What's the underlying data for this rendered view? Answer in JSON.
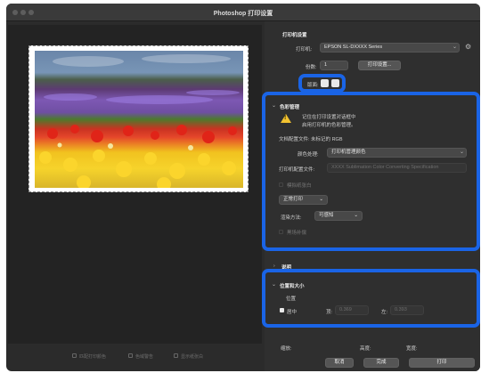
{
  "window": {
    "title": "Photoshop 打印设置"
  },
  "colors": {
    "highlight": "#1a64e6",
    "warning": "#f2c230"
  },
  "printer_setup": {
    "header": "打印机设置",
    "printer_label": "打印机:",
    "printer_value": "EPSON SL-DXXXX Series",
    "copies_label": "份数:",
    "copies_value": "1",
    "print_settings_button": "打印设置...",
    "layout_label": "版面:",
    "layout_icons": [
      "portrait-icon",
      "landscape-icon"
    ]
  },
  "color_management": {
    "header": "色彩管理",
    "warning_line1": "记住在打印设置对话框中",
    "warning_line2": "启用打印机的色彩管理。",
    "document_profile": "文档配置文件: 未标记的 RGB",
    "color_handling_label": "颜色处理:",
    "color_handling_value": "打印机管理颜色",
    "printer_profile_label": "打印机配置文件:",
    "printer_profile_value": "XXXX Sublimation Color Converting Specification",
    "paper_white_label": "模拟纸张白",
    "proof_value": "正常打印",
    "rendering_intent_label": "渲染方法:",
    "rendering_intent_value": "可感知",
    "black_point_label": "黑场补偿"
  },
  "description": {
    "header": "说明"
  },
  "position_size": {
    "header": "位置和大小",
    "position_label": "位置",
    "center_label": "居中",
    "top_label": "顶:",
    "top_value": "0.369",
    "left_label": "左:",
    "left_value": "0.393",
    "scale_label": "缩放:",
    "height_label": "高度:",
    "width_label": "宽度:"
  },
  "preview_options": {
    "match_colors": "匹配打印颜色",
    "gamut_warning": "色域警告",
    "show_paper_white": "显示纸张白"
  },
  "footer": {
    "cancel": "取消",
    "done": "完成",
    "print": "打印"
  }
}
